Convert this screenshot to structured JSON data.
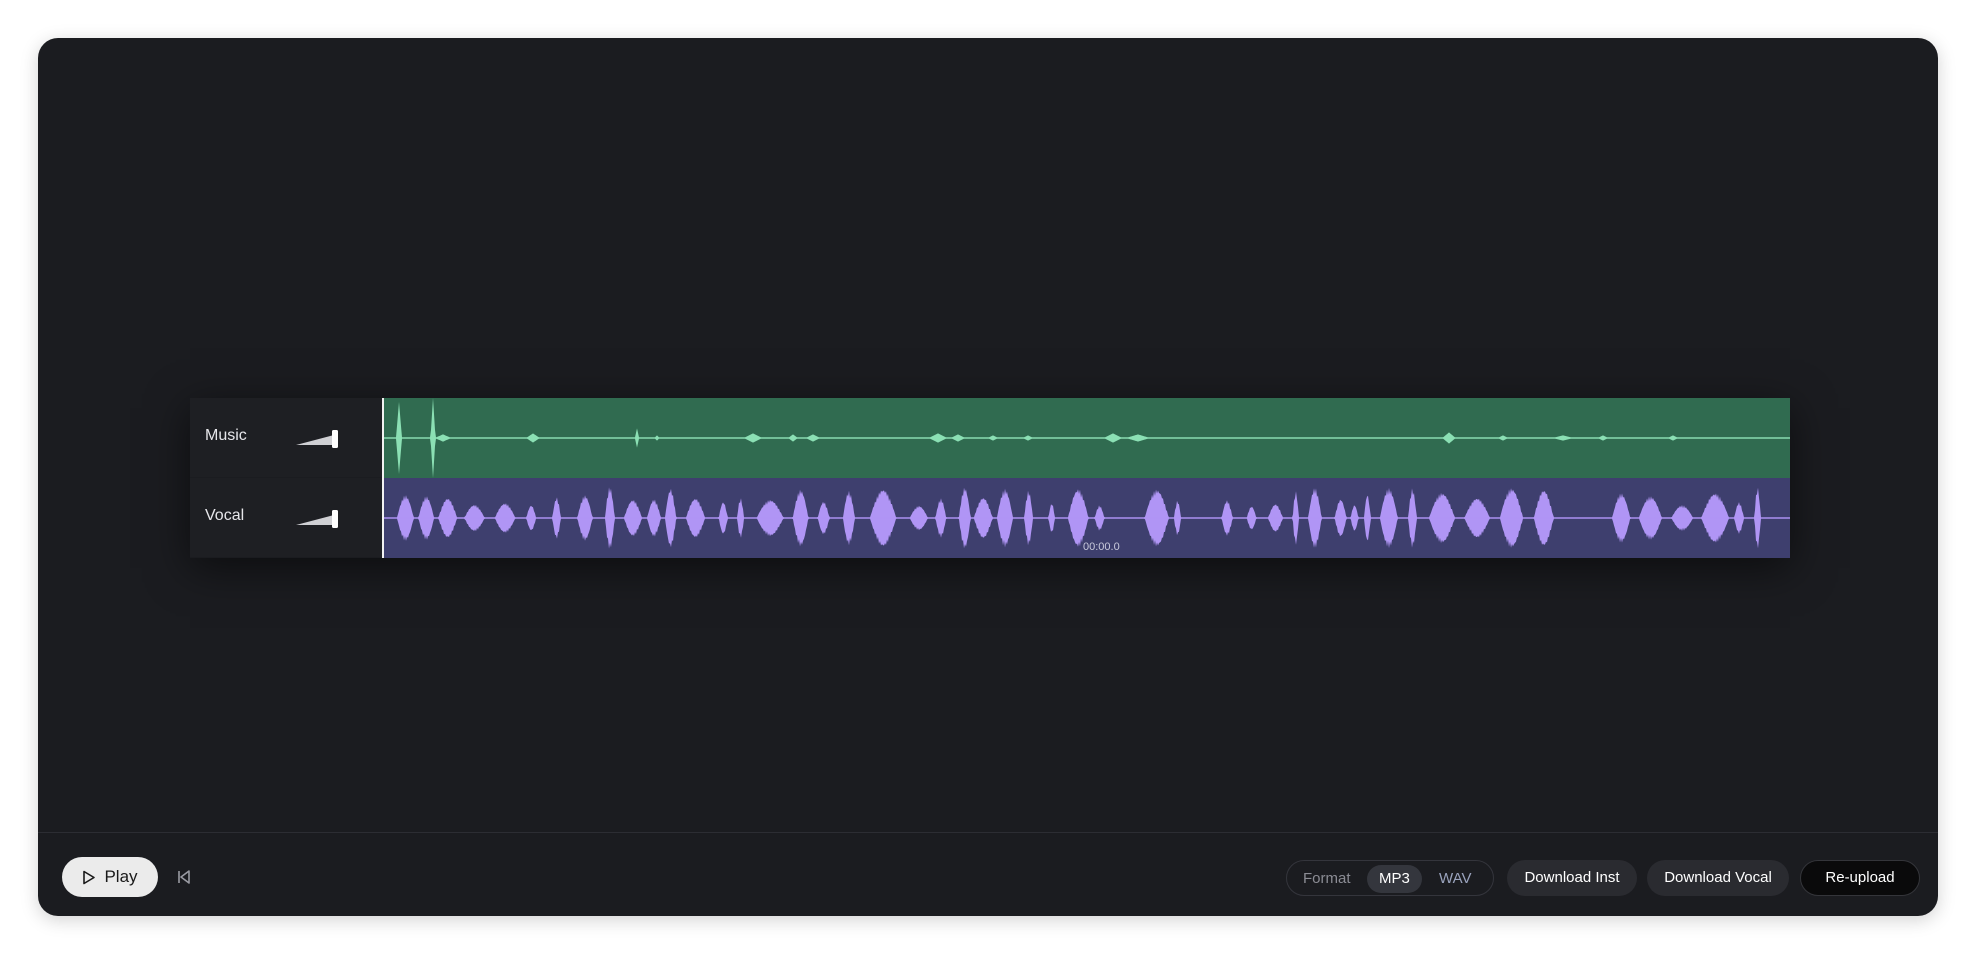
{
  "tracks": {
    "music": {
      "name": "Music",
      "volume": 1.0,
      "color": "#306b50",
      "wave_color": "#8be0b4"
    },
    "vocal": {
      "name": "Vocal",
      "volume": 1.0,
      "color": "#3e3f6e",
      "wave_color": "#b095f5"
    }
  },
  "timeline": {
    "time": "00:00.0"
  },
  "controls": {
    "play_label": "Play",
    "format_label": "Format",
    "formats": [
      "MP3",
      "WAV"
    ],
    "selected_format": "MP3",
    "download_inst_label": "Download Inst",
    "download_vocal_label": "Download Vocal",
    "reupload_label": "Re-upload"
  }
}
